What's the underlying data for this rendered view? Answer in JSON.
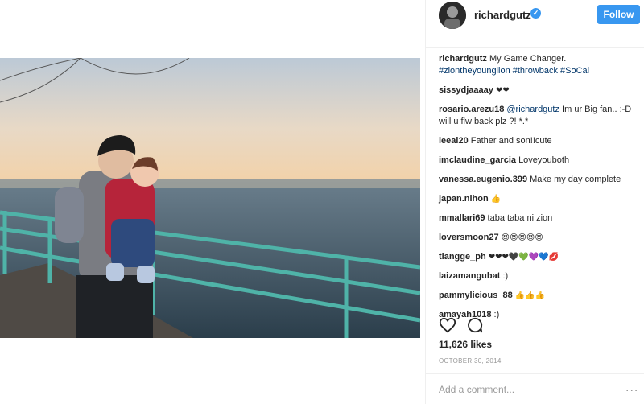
{
  "post": {
    "username": "richardgutz",
    "follow_label": "Follow",
    "caption_text": "My Game Changer.",
    "hashtags": "#ziontheyounglion #throwback #SoCal",
    "likes": "11,626 likes",
    "date": "OCTOBER 30, 2014",
    "add_comment_placeholder": "Add a comment...",
    "more_label": "..."
  },
  "comments": [
    {
      "user": "sissydjaaaay",
      "text": "",
      "emoji": "❤❤"
    },
    {
      "user": "rosario.arezu18",
      "mention": "@richardgutz",
      "text": "Im ur Big fan.. :-D will u flw back plz ?! *.*"
    },
    {
      "user": "leeai20",
      "text": "Father and son!!cute"
    },
    {
      "user": "imclaudine_garcia",
      "text": "Loveyouboth"
    },
    {
      "user": "vanessa.eugenio.399",
      "text": "Make my day complete"
    },
    {
      "user": "japan.nihon",
      "text": "",
      "emoji": "👍"
    },
    {
      "user": "mmallari69",
      "text": "taba taba ni zion"
    },
    {
      "user": "loversmoon27",
      "text": "",
      "emoji": "😍😍😍😍😍"
    },
    {
      "user": "tiangge_ph",
      "text": "",
      "emoji": "❤❤❤🖤💚💜💙💋"
    },
    {
      "user": "laizamangubat",
      "text": ":)"
    },
    {
      "user": "pammylicious_88",
      "text": "",
      "emoji": "👍👍👍"
    },
    {
      "user": "amayah1018",
      "text": ":)"
    }
  ],
  "icons": {
    "heart": "heart-icon",
    "comment": "comment-icon",
    "verified": "verified-badge-icon",
    "more": "more-options-icon"
  },
  "colors": {
    "follow": "#3897f0",
    "link": "#003569",
    "date": "#999999"
  }
}
